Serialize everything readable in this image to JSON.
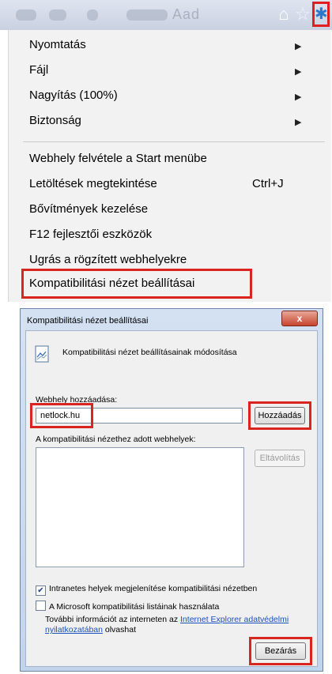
{
  "toolbar": {
    "icons": [
      "home-icon",
      "star-icon",
      "gear-icon"
    ],
    "blurred_text": "Aad",
    "highlight_color": "#e02020"
  },
  "menu": {
    "items": [
      {
        "label": "Nyomtatás",
        "submenu": true
      },
      {
        "label": "Fájl",
        "submenu": true
      },
      {
        "label": "Nagyítás (100%)",
        "submenu": true
      },
      {
        "label": "Biztonság",
        "submenu": true
      },
      {
        "label": "Webhely felvétele a Start menübe"
      },
      {
        "label": "Letöltések megtekintése",
        "shortcut": "Ctrl+J"
      },
      {
        "label": "Bővítmények kezelése"
      },
      {
        "label": "F12 fejlesztői eszközök"
      },
      {
        "label": "Ugrás a rögzített webhelyekre"
      },
      {
        "label": "Kompatibilitási nézet beállításai",
        "highlighted": true
      }
    ],
    "submenu_arrow": "▶"
  },
  "dialog": {
    "title": "Kompatibilitási nézet beállításai",
    "close_label": "x",
    "header_text": "Kompatibilitási nézet beállításainak módosítása",
    "add_site_label": "Webhely hozzáadása:",
    "site_input_value": "netlock.hu",
    "add_button": "Hozzáadás",
    "list_label": "A kompatibilitási nézethez adott webhelyek:",
    "remove_button": "Eltávolítás",
    "intranet_checkbox": {
      "label": "Intranetes helyek megjelenítése kompatibilitási nézetben",
      "checked": true
    },
    "microsoft_checkbox": {
      "label": "A Microsoft kompatibilitási listáinak használata",
      "checked": false
    },
    "info_text_before": "További információt az interneten az ",
    "info_link_part1": "Internet Explorer adatvédelmi",
    "info_link_part2": "nyilatkozatában",
    "info_text_after": " olvashat",
    "close_button": "Bezárás",
    "highlight_color": "#d9241f"
  }
}
